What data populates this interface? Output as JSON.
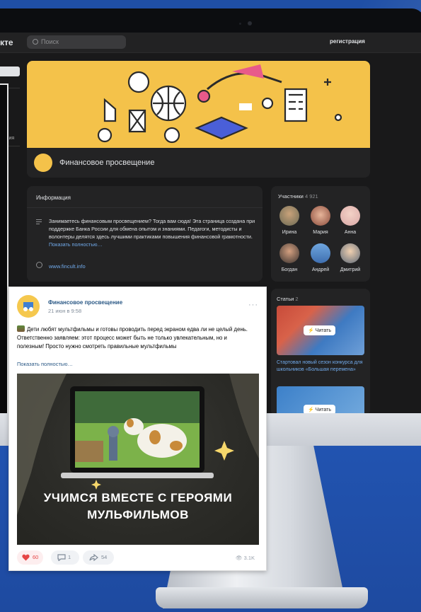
{
  "topbar": {
    "logo": "кте",
    "search_placeholder": "Поиск",
    "register": "регистрация"
  },
  "leftnav": {
    "partial_word": "жения"
  },
  "group": {
    "name": "Финансовое просвещение"
  },
  "info": {
    "heading": "Информация",
    "text": "Занимаетесь финансовым просвещением? Тогда вам сюда! Эта страница создана при поддержке Банка России для обмена опытом и знаниями. Педагоги, методисты и волонтеры делятся здесь лучшими практиками повышения финансовой грамотности.",
    "more": "Показать полностью…",
    "website": "www.fincult.info"
  },
  "members": {
    "heading": "Участники",
    "count": "4 921",
    "people": [
      "Ирина",
      "Мария",
      "Анна",
      "Богдан",
      "Андрей",
      "Дмитрий"
    ]
  },
  "articles": {
    "heading": "Статьи",
    "count": "2",
    "read_label": "Читать",
    "first_title": "Стартовал новый сезон конкурса для школьников «Большая перемена»"
  },
  "post": {
    "author": "Финансовое просвещение",
    "date": "21 июн в 9:58",
    "menu": "···",
    "text": "Дети любят мультфильмы и готовы проводить перед экраном едва ли не целый день. Ответственно заявляем: этот процесс может быть не только увлекательным, но и полезным! Просто нужно смотреть правильные мультфильмы",
    "more": "Показать полностью…",
    "image_caption_line1": "УЧИМСЯ ВМЕСТЕ С ГЕРОЯМИ",
    "image_caption_line2": "МУЛЬФИЛЬМОВ",
    "likes": "60",
    "comments": "1",
    "shares": "54",
    "views": "3.1K"
  },
  "colors": {
    "accent": "#71aaeb",
    "banner": "#f4c24a",
    "like": "#e64646",
    "page_bg": "#2358b8"
  },
  "icons": [
    "search-icon",
    "menu-lines-icon",
    "globe-icon",
    "lightning-icon",
    "heart-icon",
    "comment-icon",
    "share-icon",
    "eye-icon"
  ]
}
